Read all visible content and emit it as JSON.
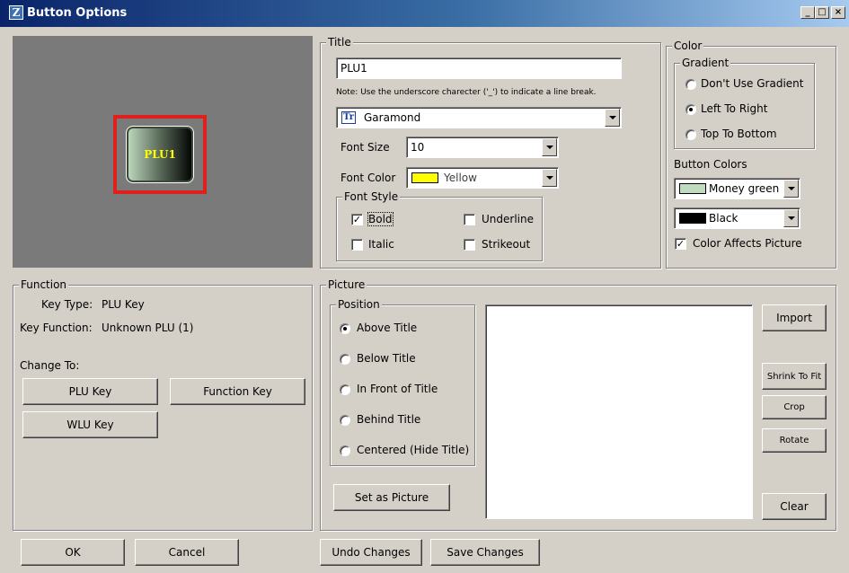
{
  "window": {
    "title": "Button Options",
    "app_icon": "Z"
  },
  "preview": {
    "button_label": "PLU1",
    "button_text_color": "#ffff00",
    "highlight_color": "#e0201c",
    "background": "#7a7a7a"
  },
  "title_group": {
    "legend": "Title",
    "title_value": "PLU1",
    "note": "Note: Use the underscore charecter ('_') to indicate a line break.",
    "font_name": "Garamond",
    "font_size_label": "Font Size",
    "font_size_value": "10",
    "font_color_label": "Font Color",
    "font_color_value": "Yellow",
    "font_color_hex": "#ffff00"
  },
  "font_style": {
    "legend": "Font Style",
    "bold": {
      "label": "Bold",
      "checked": true
    },
    "underline": {
      "label": "Underline",
      "checked": false
    },
    "italic": {
      "label": "Italic",
      "checked": false
    },
    "strikeout": {
      "label": "Strikeout",
      "checked": false
    }
  },
  "color_group": {
    "legend": "Color",
    "gradient_legend": "Gradient",
    "gradient_options": [
      {
        "label": "Don't Use Gradient",
        "selected": false
      },
      {
        "label": "Left To Right",
        "selected": true
      },
      {
        "label": "Top To Bottom",
        "selected": false
      }
    ],
    "button_colors_label": "Button Colors",
    "color1_name": "Money green",
    "color1_hex": "#c0dcc0",
    "color2_name": "Black",
    "color2_hex": "#000000",
    "affects_picture_label": "Color Affects Picture",
    "affects_picture_checked": true
  },
  "function_group": {
    "legend": "Function",
    "key_type_label": "Key Type:",
    "key_type_value": "PLU Key",
    "key_function_label": "Key Function:",
    "key_function_value": "Unknown PLU (1)",
    "change_to_label": "Change To:",
    "plu_key": "PLU Key",
    "function_key": "Function Key",
    "wlu_key": "WLU Key"
  },
  "picture_group": {
    "legend": "Picture",
    "position_legend": "Position",
    "positions": [
      {
        "label": "Above Title",
        "selected": true
      },
      {
        "label": "Below Title",
        "selected": false
      },
      {
        "label": "In Front of Title",
        "selected": false
      },
      {
        "label": "Behind Title",
        "selected": false
      },
      {
        "label": "Centered (Hide Title)",
        "selected": false
      }
    ],
    "set_as_picture": "Set as Picture",
    "import": "Import",
    "shrink_to_fit": "Shrink To Fit",
    "crop": "Crop",
    "rotate": "Rotate",
    "clear": "Clear"
  },
  "bottom_bar": {
    "ok": "OK",
    "cancel": "Cancel",
    "undo": "Undo Changes",
    "save": "Save Changes"
  }
}
